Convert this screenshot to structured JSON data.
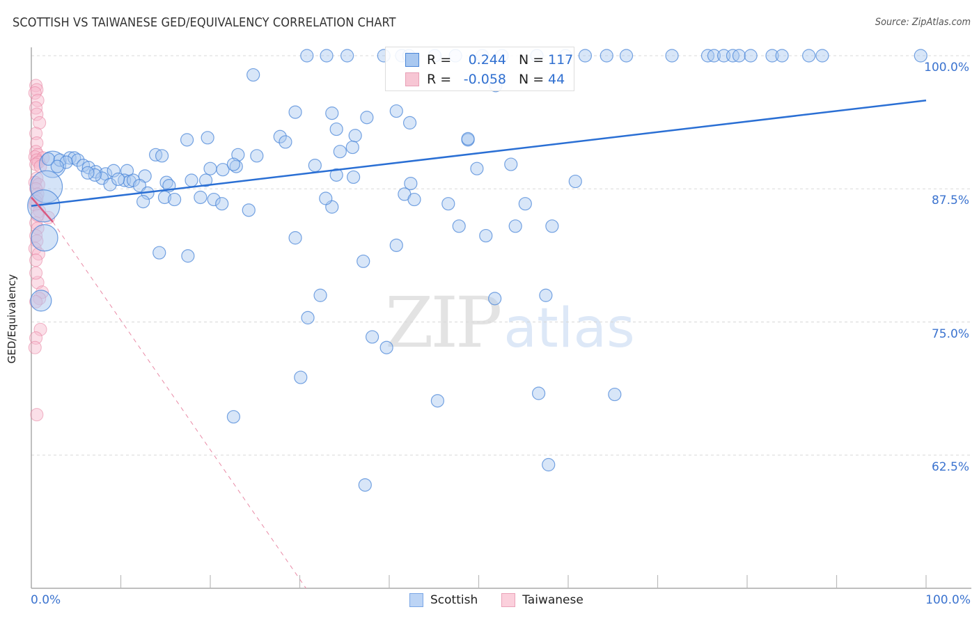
{
  "title": "SCOTTISH VS TAIWANESE GED/EQUIVALENCY CORRELATION CHART",
  "source": "Source: ZipAtlas.com",
  "watermark": {
    "zip": "ZIP",
    "atlas": "atlas"
  },
  "colors": {
    "scottish_fill": "#a9c8f0",
    "scottish_stroke": "#4a86d8",
    "scottish_line": "#2a6fd4",
    "taiwanese_fill": "#f7b9cb",
    "taiwanese_stroke": "#e57a9a",
    "taiwanese_line": "#d9587f",
    "tick_label": "#3b73cf"
  },
  "legend": {
    "rows": [
      {
        "name": "Scottish",
        "r_label": "R =",
        "r_value": "0.244",
        "n_label": "N =",
        "n_value": "117"
      },
      {
        "name": "Taiwanese",
        "r_label": "R =",
        "r_value": "-0.058",
        "n_label": "N =",
        "n_value": "44"
      }
    ]
  },
  "bottom_legend": [
    "Scottish",
    "Taiwanese"
  ],
  "chart_data": {
    "type": "scatter",
    "title": "SCOTTISH VS TAIWANESE GED/EQUIVALENCY CORRELATION CHART",
    "xlabel": "",
    "ylabel": "GED/Equivalency",
    "xlim": [
      0,
      100
    ],
    "ylim": [
      50,
      100
    ],
    "x_tick_labels": [
      "0.0%",
      "100.0%"
    ],
    "y_ticks": [
      100,
      87.5,
      75,
      62.5
    ],
    "y_tick_labels": [
      "100.0%",
      "87.5%",
      "75.0%",
      "62.5%"
    ],
    "grid": "horizontal-dashed",
    "legend_position": "top-center",
    "series": [
      {
        "name": "Scottish",
        "R": 0.244,
        "N": 117,
        "trend": {
          "x": [
            0,
            100
          ],
          "y": [
            85.9,
            95.8
          ]
        },
        "points": [
          [
            30.8,
            100
          ],
          [
            33.0,
            100
          ],
          [
            35.3,
            100
          ],
          [
            39.4,
            100
          ],
          [
            41.4,
            100
          ],
          [
            42.2,
            100
          ],
          [
            45.1,
            100
          ],
          [
            47.4,
            100
          ],
          [
            50.4,
            100
          ],
          [
            52.6,
            100
          ],
          [
            56.5,
            100
          ],
          [
            59.7,
            100
          ],
          [
            61.9,
            100
          ],
          [
            64.3,
            100
          ],
          [
            66.5,
            100
          ],
          [
            71.6,
            100
          ],
          [
            75.6,
            100
          ],
          [
            76.3,
            100
          ],
          [
            77.4,
            100
          ],
          [
            78.4,
            100
          ],
          [
            79.1,
            100
          ],
          [
            80.4,
            100
          ],
          [
            82.8,
            100
          ],
          [
            83.9,
            100
          ],
          [
            86.9,
            100
          ],
          [
            88.4,
            100
          ],
          [
            99.4,
            100
          ],
          [
            24.8,
            98.2
          ],
          [
            51.9,
            97.2
          ],
          [
            37.5,
            94.2
          ],
          [
            33.6,
            94.6
          ],
          [
            29.5,
            94.7
          ],
          [
            40.8,
            94.8
          ],
          [
            42.3,
            93.7
          ],
          [
            34.1,
            93.1
          ],
          [
            36.2,
            92.5
          ],
          [
            17.4,
            92.1
          ],
          [
            19.7,
            92.3
          ],
          [
            27.8,
            92.4
          ],
          [
            48.8,
            92.1
          ],
          [
            35.9,
            91.4
          ],
          [
            28.4,
            91.9
          ],
          [
            34.5,
            91.0
          ],
          [
            48.8,
            92.2
          ],
          [
            23.1,
            90.7
          ],
          [
            25.2,
            90.6
          ],
          [
            13.9,
            90.7
          ],
          [
            14.6,
            90.6
          ],
          [
            1.9,
            90.3
          ],
          [
            3.2,
            90.2
          ],
          [
            4.3,
            90.4
          ],
          [
            4.8,
            90.4
          ],
          [
            5.2,
            90.2
          ],
          [
            3.9,
            90.0
          ],
          [
            2.9,
            89.6
          ],
          [
            5.8,
            89.7
          ],
          [
            6.4,
            89.5
          ],
          [
            7.2,
            89.1
          ],
          [
            8.3,
            88.9
          ],
          [
            10.7,
            89.2
          ],
          [
            12.7,
            88.7
          ],
          [
            15.1,
            88.1
          ],
          [
            15.4,
            87.8
          ],
          [
            20.0,
            89.4
          ],
          [
            22.9,
            89.6
          ],
          [
            21.4,
            89.3
          ],
          [
            22.6,
            89.8
          ],
          [
            31.7,
            89.7
          ],
          [
            34.1,
            88.8
          ],
          [
            36.0,
            88.6
          ],
          [
            42.4,
            88.0
          ],
          [
            49.8,
            89.4
          ],
          [
            60.8,
            88.2
          ],
          [
            53.6,
            89.8
          ],
          [
            7.9,
            88.5
          ],
          [
            8.8,
            87.9
          ],
          [
            10.4,
            88.3
          ],
          [
            11.0,
            88.2
          ],
          [
            11.4,
            88.3
          ],
          [
            9.2,
            89.2
          ],
          [
            12.1,
            87.8
          ],
          [
            7.1,
            88.8
          ],
          [
            6.3,
            89.0
          ],
          [
            9.7,
            88.4
          ],
          [
            17.9,
            88.3
          ],
          [
            19.5,
            88.3
          ],
          [
            13.0,
            87.1
          ],
          [
            14.9,
            86.7
          ],
          [
            16.0,
            86.5
          ],
          [
            20.4,
            86.5
          ],
          [
            18.9,
            86.7
          ],
          [
            12.5,
            86.3
          ],
          [
            21.3,
            86.1
          ],
          [
            33.6,
            85.8
          ],
          [
            41.7,
            87.0
          ],
          [
            42.8,
            86.5
          ],
          [
            32.9,
            86.6
          ],
          [
            24.3,
            85.5
          ],
          [
            46.6,
            86.1
          ],
          [
            55.2,
            86.1
          ],
          [
            54.1,
            84.0
          ],
          [
            47.8,
            84.0
          ],
          [
            58.2,
            84.0
          ],
          [
            50.8,
            83.1
          ],
          [
            40.8,
            82.2
          ],
          [
            29.5,
            82.9
          ],
          [
            14.3,
            81.5
          ],
          [
            37.1,
            80.7
          ],
          [
            17.5,
            81.2
          ],
          [
            57.5,
            77.5
          ],
          [
            51.8,
            77.2
          ],
          [
            32.3,
            77.5
          ],
          [
            30.9,
            75.4
          ],
          [
            38.1,
            73.6
          ],
          [
            39.7,
            72.6
          ],
          [
            30.1,
            69.8
          ],
          [
            65.2,
            68.2
          ],
          [
            56.7,
            68.3
          ],
          [
            45.4,
            67.6
          ],
          [
            22.6,
            66.1
          ],
          [
            57.8,
            61.6
          ],
          [
            37.3,
            59.7
          ]
        ]
      },
      {
        "name": "Taiwanese",
        "R": -0.058,
        "N": 44,
        "trend": {
          "x": [
            0,
            2.4
          ],
          "y": [
            86.7,
            84.4
          ],
          "extension": {
            "x": [
              2.4,
              30.7
            ],
            "y": [
              84.4,
              50
            ]
          }
        },
        "points": [
          [
            0.2,
            97.2
          ],
          [
            0.3,
            96.8
          ],
          [
            0.1,
            96.5
          ],
          [
            0.4,
            95.8
          ],
          [
            0.2,
            95.1
          ],
          [
            0.3,
            94.5
          ],
          [
            0.6,
            93.7
          ],
          [
            0.2,
            92.7
          ],
          [
            0.3,
            91.8
          ],
          [
            0.2,
            91.0
          ],
          [
            0.4,
            90.7
          ],
          [
            0.1,
            90.5
          ],
          [
            1.0,
            90.4
          ],
          [
            0.3,
            90.2
          ],
          [
            0.5,
            90.0
          ],
          [
            0.2,
            89.8
          ],
          [
            0.7,
            89.6
          ],
          [
            0.3,
            88.5
          ],
          [
            0.1,
            88.1
          ],
          [
            0.5,
            87.9
          ],
          [
            0.2,
            87.5
          ],
          [
            0.4,
            87.0
          ],
          [
            0.3,
            86.6
          ],
          [
            0.1,
            86.0
          ],
          [
            0.6,
            85.4
          ],
          [
            1.6,
            84.8
          ],
          [
            0.2,
            84.3
          ],
          [
            0.4,
            83.8
          ],
          [
            0.2,
            83.1
          ],
          [
            0.3,
            82.6
          ],
          [
            0.1,
            81.9
          ],
          [
            0.5,
            81.4
          ],
          [
            0.2,
            80.8
          ],
          [
            0.4,
            78.7
          ],
          [
            0.9,
            77.8
          ],
          [
            0.6,
            77.2
          ],
          [
            0.2,
            76.9
          ],
          [
            0.7,
            74.3
          ],
          [
            0.2,
            73.5
          ],
          [
            0.1,
            72.6
          ],
          [
            0.3,
            66.3
          ],
          [
            0.2,
            86.3
          ],
          [
            0.4,
            85.0
          ],
          [
            0.2,
            79.6
          ]
        ]
      }
    ],
    "large_points": [
      {
        "series": "Scottish",
        "x": 1.6,
        "y": 89.8,
        "size": "large"
      },
      {
        "series": "Scottish",
        "x": 0.9,
        "y": 87.7,
        "size": "xlarge"
      },
      {
        "series": "Scottish",
        "x": 0.6,
        "y": 85.9,
        "size": "xlarge"
      },
      {
        "series": "Scottish",
        "x": 0.7,
        "y": 82.9,
        "size": "large"
      },
      {
        "series": "Scottish",
        "x": 0.3,
        "y": 77.0,
        "size": "medium"
      }
    ]
  }
}
